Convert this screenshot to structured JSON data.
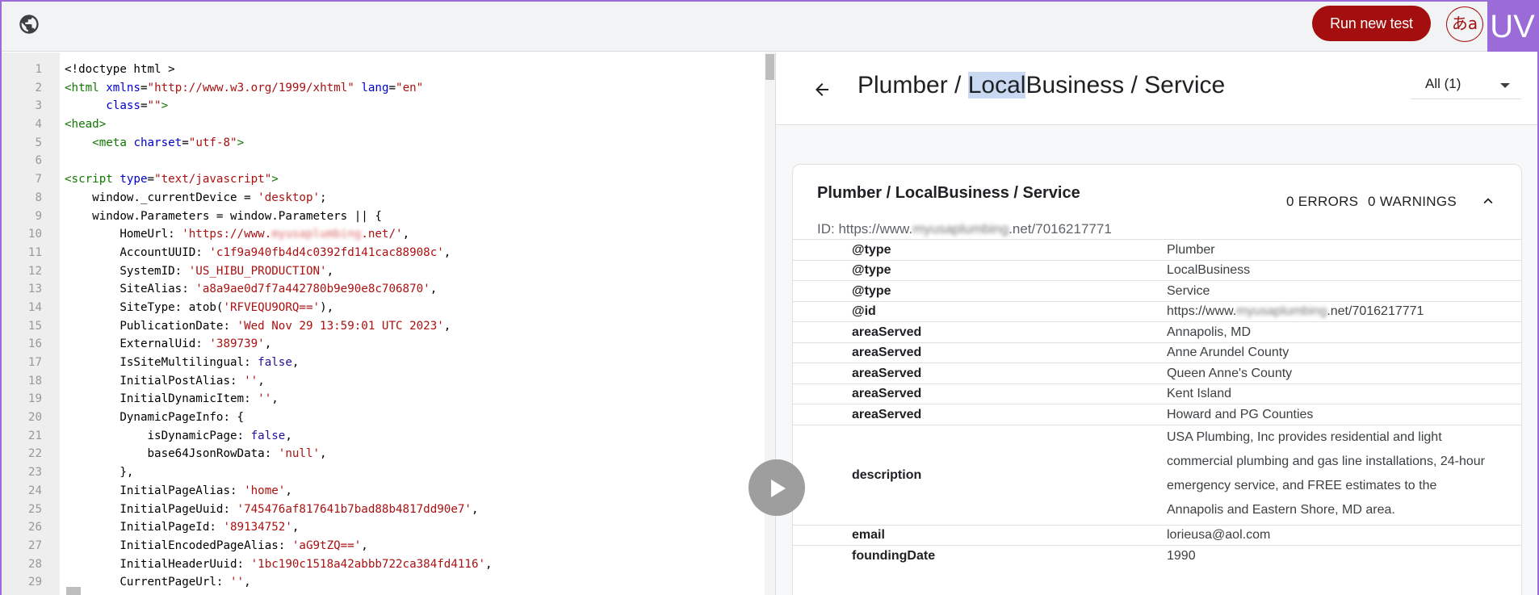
{
  "topbar": {
    "run_label": "Run new test",
    "lang_label": "あa",
    "logo_text": "UV"
  },
  "code": {
    "lines": [
      {
        "n": "1",
        "html": "&lt;!doctype html &gt;"
      },
      {
        "n": "2",
        "html": "<span class='tag'>&lt;html</span> <span class='attr'>xmlns</span>=<span class='str'>\"http://www.w3.org/1999/xhtml\"</span> <span class='attr'>lang</span>=<span class='str'>\"en\"</span>"
      },
      {
        "n": "3",
        "html": "      <span class='attr'>class</span>=<span class='str'>\"\"</span><span class='tag'>&gt;</span>"
      },
      {
        "n": "4",
        "html": "<span class='tag'>&lt;head&gt;</span>"
      },
      {
        "n": "5",
        "html": "    <span class='tag'>&lt;meta</span> <span class='attr'>charset</span>=<span class='str'>\"utf-8\"</span><span class='tag'>&gt;</span>"
      },
      {
        "n": "6",
        "html": ""
      },
      {
        "n": "7",
        "html": "<span class='tag'>&lt;script</span> <span class='attr'>type</span>=<span class='str'>\"text/javascript\"</span><span class='tag'>&gt;</span>"
      },
      {
        "n": "8",
        "html": "    window._currentDevice = <span class='str'>'desktop'</span>;"
      },
      {
        "n": "9",
        "html": "    window.Parameters = window.Parameters || {"
      },
      {
        "n": "10",
        "html": "        HomeUrl: <span class='str'>'https://www.<span class='blur'>myusaplumbing</span>.net/'</span>,"
      },
      {
        "n": "11",
        "html": "        AccountUUID: <span class='str'>'c1f9a940fb4d4c0392fd141cac88908c'</span>,"
      },
      {
        "n": "12",
        "html": "        SystemID: <span class='str'>'US_HIBU_PRODUCTION'</span>,"
      },
      {
        "n": "13",
        "html": "        SiteAlias: <span class='str'>'a8a9ae0d7f7a442780b9e90e8c706870'</span>,"
      },
      {
        "n": "14",
        "html": "        SiteType: atob(<span class='str'>'RFVEQU9ORQ=='</span>),"
      },
      {
        "n": "15",
        "html": "        PublicationDate: <span class='str'>'Wed Nov 29 13:59:01 UTC 2023'</span>,"
      },
      {
        "n": "16",
        "html": "        ExternalUid: <span class='str'>'389739'</span>,"
      },
      {
        "n": "17",
        "html": "        IsSiteMultilingual: <span class='kw'>false</span>,"
      },
      {
        "n": "18",
        "html": "        InitialPostAlias: <span class='str'>''</span>,"
      },
      {
        "n": "19",
        "html": "        InitialDynamicItem: <span class='str'>''</span>,"
      },
      {
        "n": "20",
        "html": "        DynamicPageInfo: {"
      },
      {
        "n": "21",
        "html": "            isDynamicPage: <span class='kw'>false</span>,"
      },
      {
        "n": "22",
        "html": "            base64JsonRowData: <span class='str'>'null'</span>,"
      },
      {
        "n": "23",
        "html": "        },"
      },
      {
        "n": "24",
        "html": "        InitialPageAlias: <span class='str'>'home'</span>,"
      },
      {
        "n": "25",
        "html": "        InitialPageUuid: <span class='str'>'745476af817641b7bad88b4817dd90e7'</span>,"
      },
      {
        "n": "26",
        "html": "        InitialPageId: <span class='str'>'89134752'</span>,"
      },
      {
        "n": "27",
        "html": "        InitialEncodedPageAlias: <span class='str'>'aG9tZQ=='</span>,"
      },
      {
        "n": "28",
        "html": "        InitialHeaderUuid: <span class='str'>'1bc190c1518a42abbb722ca384fd4116'</span>,"
      },
      {
        "n": "29",
        "html": "        CurrentPageUrl: <span class='str'>''</span>,"
      }
    ]
  },
  "results": {
    "title_before": "Plumber / ",
    "title_highlight": "Local",
    "title_after": "Business / Service",
    "filter_label": "All (1)",
    "card": {
      "title": "Plumber / LocalBusiness / Service",
      "errors": "0 ERRORS",
      "warnings": "0 WARNINGS",
      "id_prefix": "ID: https://www.",
      "id_blurred": "myusaplumbing",
      "id_suffix": ".net/7016217771"
    },
    "properties": [
      {
        "key": "@type",
        "value": "Plumber"
      },
      {
        "key": "@type",
        "value": "LocalBusiness"
      },
      {
        "key": "@type",
        "value": "Service"
      },
      {
        "key": "@id",
        "value_prefix": "https://www.",
        "value_blurred": "myusaplumbing",
        "value_suffix": ".net/7016217771"
      },
      {
        "key": "areaServed",
        "value": "Annapolis, MD"
      },
      {
        "key": "areaServed",
        "value": "Anne Arundel County"
      },
      {
        "key": "areaServed",
        "value": "Queen Anne's County"
      },
      {
        "key": "areaServed",
        "value": "Kent Island"
      },
      {
        "key": "areaServed",
        "value": "Howard and PG Counties"
      },
      {
        "key": "description",
        "value": "USA Plumbing, Inc provides residential and light commercial plumbing and gas line installations, 24-hour emergency service, and FREE estimates to the Annapolis and Eastern Shore, MD area."
      },
      {
        "key": "email",
        "value": "lorieusa@aol.com"
      },
      {
        "key": "foundingDate",
        "value": "1990"
      }
    ]
  },
  "colors": {
    "accent": "#a50e0e",
    "logo_bg": "#9b6bd8",
    "highlight": "#c9d9f2"
  }
}
